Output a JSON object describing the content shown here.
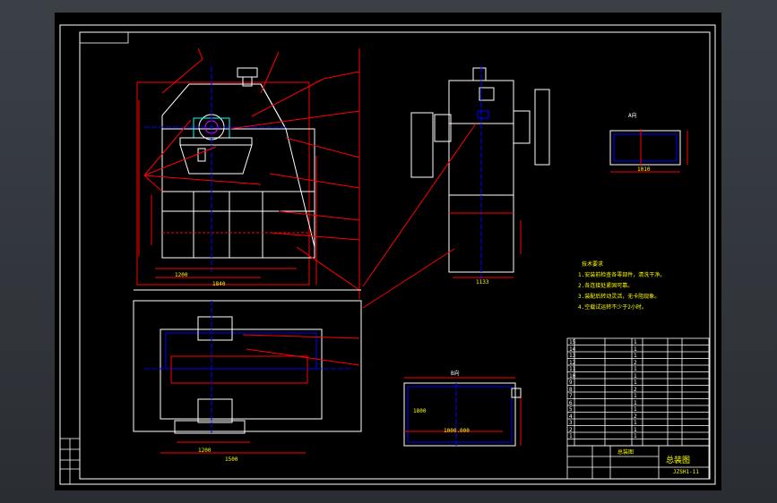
{
  "views": {
    "detail_a": "A向",
    "detail_b": "B向"
  },
  "dims": {
    "detail_a": "1010",
    "detail_b_1": "1800",
    "detail_b_2": "1000.000",
    "front_bottom": "1840",
    "front_left": "1200",
    "top_1": "1200",
    "top_2": "1500",
    "side": "1133"
  },
  "notes": {
    "heading": "技术要求",
    "lines": [
      "1.安装前检查各零部件，清洗干净。",
      "2.各连接处紧固可靠。",
      "3.装配后转动灵活，无卡阻现象。",
      "4.空载试运转不少于2小时。"
    ]
  },
  "parts_list": {
    "rows": [
      [
        "15",
        "",
        "",
        "1",
        ""
      ],
      [
        "14",
        "",
        "",
        "1",
        ""
      ],
      [
        "13",
        "",
        "",
        "1",
        ""
      ],
      [
        "12",
        "",
        "",
        "2",
        ""
      ],
      [
        "11",
        "",
        "",
        "1",
        ""
      ],
      [
        "10",
        "",
        "",
        "1",
        ""
      ],
      [
        "9",
        "",
        "",
        "1",
        ""
      ],
      [
        "8",
        "",
        "",
        "2",
        ""
      ],
      [
        "7",
        "",
        "",
        "1",
        ""
      ],
      [
        "6",
        "",
        "",
        "1",
        ""
      ],
      [
        "5",
        "",
        "",
        "1",
        ""
      ],
      [
        "4",
        "",
        "",
        "2",
        ""
      ],
      [
        "3",
        "",
        "",
        "1",
        ""
      ],
      [
        "2",
        "",
        "",
        "1",
        ""
      ],
      [
        "1",
        "",
        "",
        "1",
        ""
      ]
    ]
  },
  "title_block": {
    "caption": "总装图",
    "title": "总装图",
    "code": "JZSH1-11"
  }
}
